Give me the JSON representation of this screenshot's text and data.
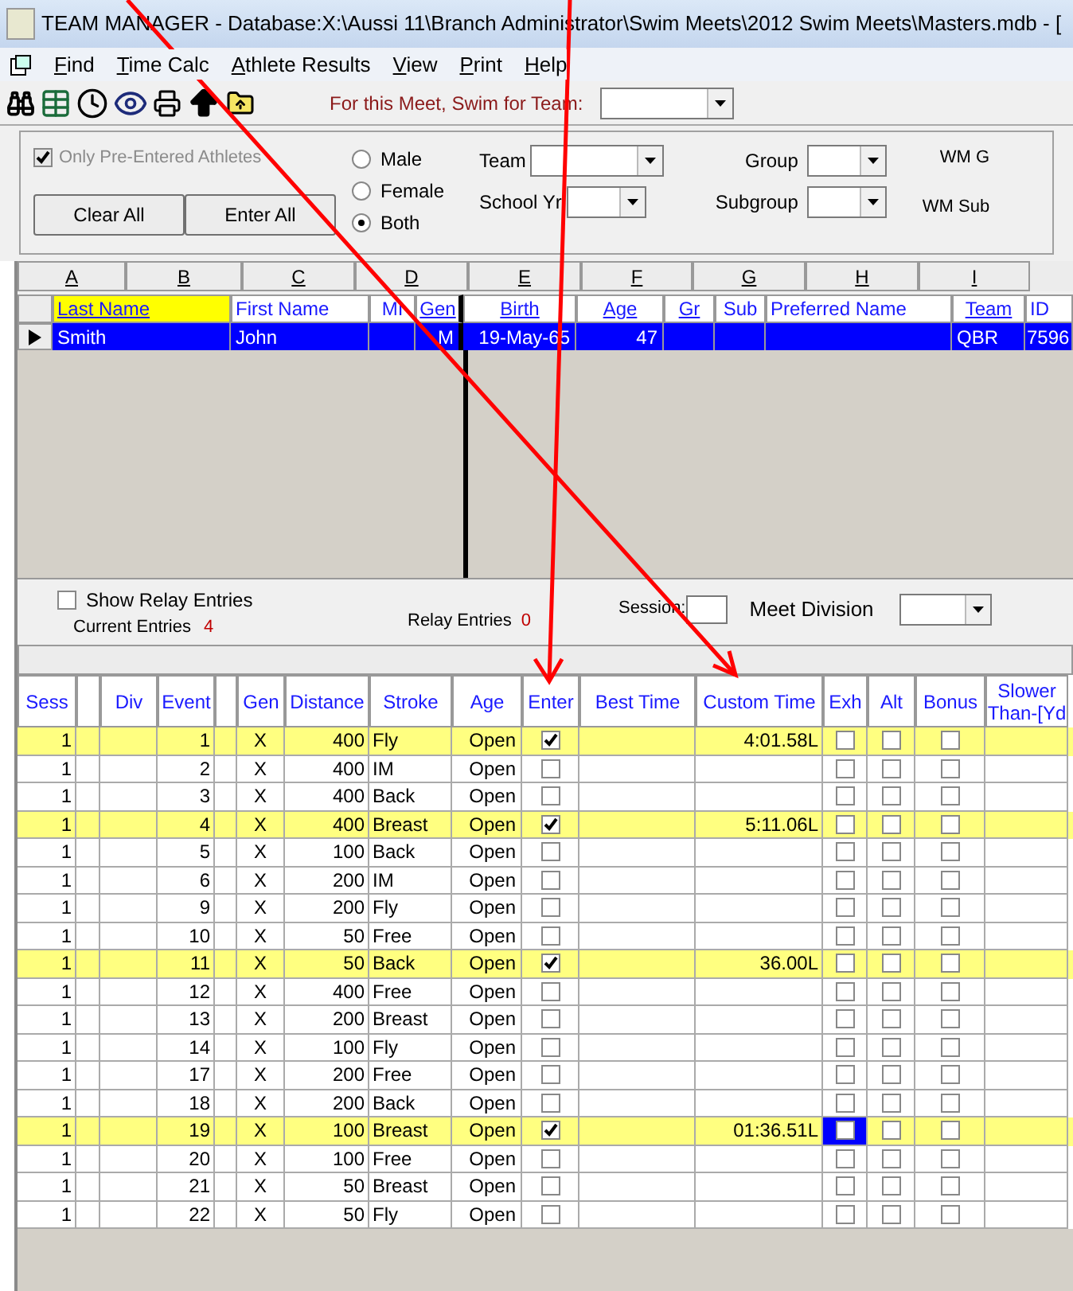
{
  "window": {
    "title": "TEAM MANAGER - Database:X:\\Aussi 11\\Branch Administrator\\Swim Meets\\2012 Swim Meets\\Masters.mdb - ["
  },
  "menu": [
    "Find",
    "Time Calc",
    "Athlete Results",
    "View",
    "Print",
    "Help"
  ],
  "toolbar": {
    "team_label": "For this Meet, Swim for Team:"
  },
  "filters": {
    "only_pre_entered": {
      "label": "Only Pre-Entered Athletes",
      "checked": true,
      "disabled": true
    },
    "gender": [
      {
        "label": "Male",
        "selected": false
      },
      {
        "label": "Female",
        "selected": false
      },
      {
        "label": "Both",
        "selected": true
      }
    ],
    "buttons": [
      "Clear All",
      "Enter All"
    ],
    "team_label": "Team",
    "school_yr_label": "School Yr",
    "group_label": "Group",
    "subgroup_label": "Subgroup",
    "wm_group_label": "WM G",
    "wm_sub_label": "WM Sub"
  },
  "letters": [
    "A",
    "B",
    "C",
    "D",
    "E",
    "F",
    "G",
    "H",
    "I"
  ],
  "athletes": {
    "columns": [
      {
        "label": "Last Name",
        "underlined": true,
        "selected": true
      },
      {
        "label": "First Name",
        "underlined": false,
        "selected": false
      },
      {
        "label": "MI",
        "underlined": false,
        "selected": false
      },
      {
        "label": "Gen",
        "underlined": true,
        "selected": false
      },
      {
        "label": "Birth",
        "underlined": true,
        "selected": false
      },
      {
        "label": "Age",
        "underlined": true,
        "selected": false
      },
      {
        "label": "Gr",
        "underlined": true,
        "selected": false
      },
      {
        "label": "Sub",
        "underlined": false,
        "selected": false
      },
      {
        "label": "Preferred Name",
        "underlined": false,
        "selected": false
      },
      {
        "label": "Team",
        "underlined": true,
        "selected": false
      },
      {
        "label": "ID",
        "underlined": false,
        "selected": false
      }
    ],
    "rows": [
      {
        "selected": true,
        "cells": [
          "Smith",
          "John",
          null,
          "M",
          "19-May-65",
          "47",
          null,
          null,
          null,
          "QBR",
          "7596"
        ]
      }
    ]
  },
  "relay": {
    "show_label": "Show Relay Entries",
    "show_checked": false,
    "current_label": "Current Entries",
    "current_count": "4",
    "relay_label": "Relay Entries",
    "relay_count": "0",
    "session_label": "Session:",
    "division_label": "Meet Division"
  },
  "events": {
    "columns": [
      {
        "kind": "text",
        "label": "Sess"
      },
      {
        "kind": "blank"
      },
      {
        "kind": "text",
        "label": "Div"
      },
      {
        "kind": "text",
        "label": "Event"
      },
      {
        "kind": "blank"
      },
      {
        "kind": "text",
        "label": "Gen"
      },
      {
        "kind": "text",
        "label": "Distance"
      },
      {
        "kind": "text",
        "label": "Stroke"
      },
      {
        "kind": "text",
        "label": "Age"
      },
      {
        "kind": "text",
        "label": "Enter"
      },
      {
        "kind": "text",
        "label": "Best Time"
      },
      {
        "kind": "text",
        "label": "Custom Time"
      },
      {
        "kind": "text",
        "label": "Exh"
      },
      {
        "kind": "text",
        "label": "Alt"
      },
      {
        "kind": "text",
        "label": "Bonus"
      },
      {
        "kind": "text",
        "label": "Slower Than-[Yd"
      }
    ],
    "rows": [
      {
        "sess": "1",
        "event": "1",
        "gen": "X",
        "distance": "400",
        "stroke": "Fly",
        "age": "Open",
        "entered": true,
        "custom_time": "4:01.58L",
        "exh": false,
        "alt": false,
        "bonus": false,
        "selected": false
      },
      {
        "sess": "1",
        "event": "2",
        "gen": "X",
        "distance": "400",
        "stroke": "IM",
        "age": "Open",
        "entered": false,
        "exh": false,
        "alt": false,
        "bonus": false,
        "selected": false
      },
      {
        "sess": "1",
        "event": "3",
        "gen": "X",
        "distance": "400",
        "stroke": "Back",
        "age": "Open",
        "entered": false,
        "exh": false,
        "alt": false,
        "bonus": false,
        "selected": false
      },
      {
        "sess": "1",
        "event": "4",
        "gen": "X",
        "distance": "400",
        "stroke": "Breast",
        "age": "Open",
        "entered": true,
        "custom_time": "5:11.06L",
        "exh": false,
        "alt": false,
        "bonus": false,
        "selected": false
      },
      {
        "sess": "1",
        "event": "5",
        "gen": "X",
        "distance": "100",
        "stroke": "Back",
        "age": "Open",
        "entered": false,
        "exh": false,
        "alt": false,
        "bonus": false,
        "selected": false
      },
      {
        "sess": "1",
        "event": "6",
        "gen": "X",
        "distance": "200",
        "stroke": "IM",
        "age": "Open",
        "entered": false,
        "exh": false,
        "alt": false,
        "bonus": false,
        "selected": false
      },
      {
        "sess": "1",
        "event": "9",
        "gen": "X",
        "distance": "200",
        "stroke": "Fly",
        "age": "Open",
        "entered": false,
        "exh": false,
        "alt": false,
        "bonus": false,
        "selected": false
      },
      {
        "sess": "1",
        "event": "10",
        "gen": "X",
        "distance": "50",
        "stroke": "Free",
        "age": "Open",
        "entered": false,
        "exh": false,
        "alt": false,
        "bonus": false,
        "selected": false
      },
      {
        "sess": "1",
        "event": "11",
        "gen": "X",
        "distance": "50",
        "stroke": "Back",
        "age": "Open",
        "entered": true,
        "custom_time": "36.00L",
        "exh": false,
        "alt": false,
        "bonus": false,
        "selected": false
      },
      {
        "sess": "1",
        "event": "12",
        "gen": "X",
        "distance": "400",
        "stroke": "Free",
        "age": "Open",
        "entered": false,
        "exh": false,
        "alt": false,
        "bonus": false,
        "selected": false
      },
      {
        "sess": "1",
        "event": "13",
        "gen": "X",
        "distance": "200",
        "stroke": "Breast",
        "age": "Open",
        "entered": false,
        "exh": false,
        "alt": false,
        "bonus": false,
        "selected": false
      },
      {
        "sess": "1",
        "event": "14",
        "gen": "X",
        "distance": "100",
        "stroke": "Fly",
        "age": "Open",
        "entered": false,
        "exh": false,
        "alt": false,
        "bonus": false,
        "selected": false
      },
      {
        "sess": "1",
        "event": "17",
        "gen": "X",
        "distance": "200",
        "stroke": "Free",
        "age": "Open",
        "entered": false,
        "exh": false,
        "alt": false,
        "bonus": false,
        "selected": false
      },
      {
        "sess": "1",
        "event": "18",
        "gen": "X",
        "distance": "200",
        "stroke": "Back",
        "age": "Open",
        "entered": false,
        "exh": false,
        "alt": false,
        "bonus": false,
        "selected": false
      },
      {
        "sess": "1",
        "event": "19",
        "gen": "X",
        "distance": "100",
        "stroke": "Breast",
        "age": "Open",
        "entered": true,
        "custom_time": "01:36.51L",
        "exh": false,
        "alt": false,
        "bonus": false,
        "selected": true
      },
      {
        "sess": "1",
        "event": "20",
        "gen": "X",
        "distance": "100",
        "stroke": "Free",
        "age": "Open",
        "entered": false,
        "exh": false,
        "alt": false,
        "bonus": false,
        "selected": false
      },
      {
        "sess": "1",
        "event": "21",
        "gen": "X",
        "distance": "50",
        "stroke": "Breast",
        "age": "Open",
        "entered": false,
        "exh": false,
        "alt": false,
        "bonus": false,
        "selected": false
      },
      {
        "sess": "1",
        "event": "22",
        "gen": "X",
        "distance": "50",
        "stroke": "Fly",
        "age": "Open",
        "entered": false,
        "exh": false,
        "alt": false,
        "bonus": false,
        "selected": false
      }
    ]
  }
}
